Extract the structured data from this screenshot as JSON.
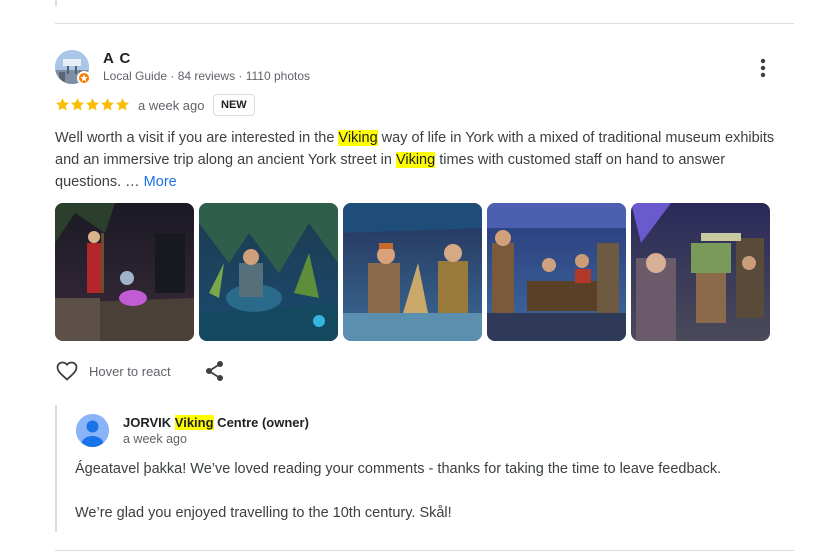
{
  "review": {
    "author": {
      "name": "A C",
      "meta": "Local Guide · 84 reviews · 1110 photos"
    },
    "rating": 5,
    "time": "a week ago",
    "badge": "NEW",
    "text": {
      "p1": "Well worth a visit if you are interested in the ",
      "hl1": "Viking",
      "p2": " way of life in York with a mixed of traditional museum exhibits and an immersive trip along an ancient York street in ",
      "hl2": "Viking",
      "p3": " times with customed staff on hand to answer questions. … ",
      "more": "More"
    },
    "photo_count": 5,
    "actions": {
      "react_label": "Hover to react"
    }
  },
  "owner_reply": {
    "name_pre": "JORVIK ",
    "name_hl": "Viking",
    "name_post": " Centre (owner)",
    "time": "a week ago",
    "paragraphs": [
      "Ágeatavel þakka! We’ve loved reading your comments - thanks for taking the time to leave feedback.",
      "We’re glad you enjoyed travelling to the 10th century. Skål!"
    ]
  },
  "colors": {
    "star": "#fbbc04",
    "highlight": "#ffff00",
    "link": "#1a73e8",
    "badge": "#f57c00"
  }
}
